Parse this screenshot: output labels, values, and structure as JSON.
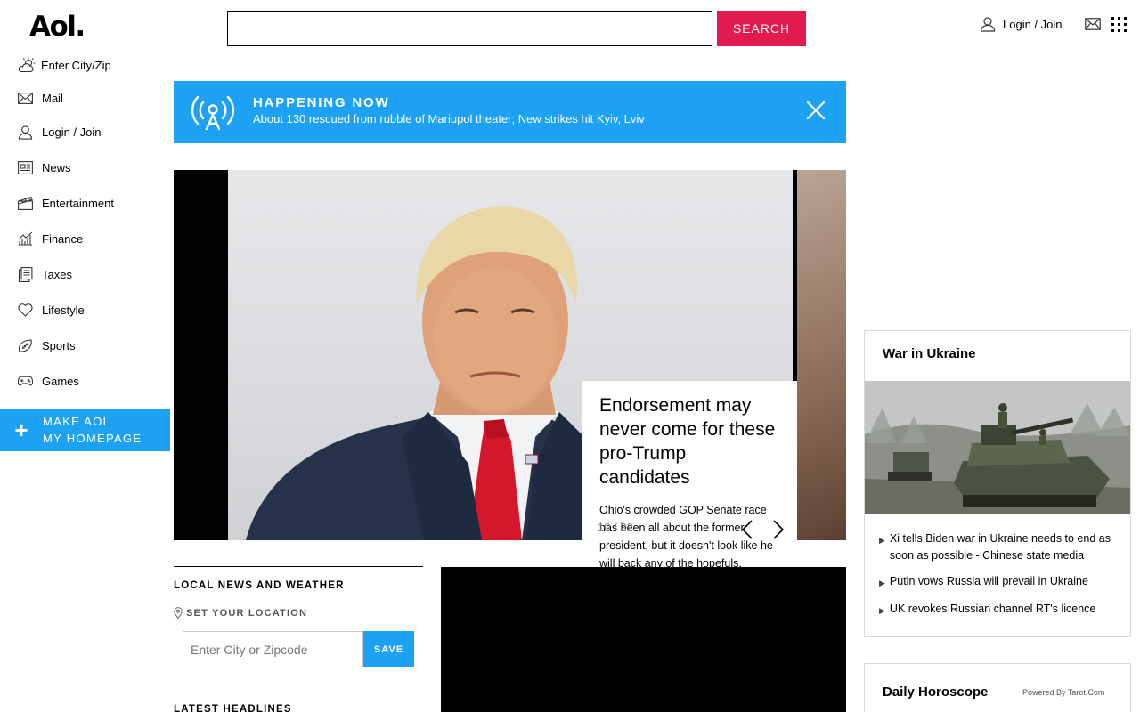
{
  "header": {
    "logo": "Aol.",
    "search_button": "SEARCH",
    "login_label": "Login / Join"
  },
  "sidebar": {
    "weather_label": "Enter City/Zip",
    "items": [
      {
        "label": "Mail",
        "icon": "mail-icon"
      },
      {
        "label": "Login / Join",
        "icon": "user-icon"
      },
      {
        "label": "News",
        "icon": "newspaper-icon"
      },
      {
        "label": "Entertainment",
        "icon": "clapperboard-icon"
      },
      {
        "label": "Finance",
        "icon": "chart-icon"
      },
      {
        "label": "Taxes",
        "icon": "documents-icon"
      },
      {
        "label": "Lifestyle",
        "icon": "heart-icon"
      },
      {
        "label": "Sports",
        "icon": "football-icon"
      },
      {
        "label": "Games",
        "icon": "gamepad-icon"
      }
    ],
    "make_homepage": {
      "line1": "MAKE AOL",
      "line2": "MY HOMEPAGE"
    }
  },
  "happening": {
    "label": "HAPPENING NOW",
    "text": "About 130 rescued from rubble of Mariupol theater; New strikes hit Kyiv, Lviv"
  },
  "carousel": {
    "headline": "Endorsement may never come for these pro-Trump candidates",
    "summary": "Ohio's crowded GOP Senate race has been all about the former president, but it doesn't look like he will back any of the hopefuls.",
    "counter": "10 / 32"
  },
  "local": {
    "title": "LOCAL NEWS AND WEATHER",
    "set_location": "SET YOUR LOCATION",
    "input_placeholder": "Enter City or Zipcode",
    "save_label": "SAVE",
    "latest_title": "LATEST HEADLINES"
  },
  "ukraine": {
    "title": "War in Ukraine",
    "headlines": [
      "Xi tells Biden war in Ukraine needs to end as soon as possible - Chinese state media",
      "Putin vows Russia will prevail in Ukraine",
      "UK revokes Russian channel RT's licence"
    ]
  },
  "horoscope": {
    "title": "Daily Horoscope",
    "powered": "Powered By Tarot.Com"
  },
  "colors": {
    "accent_blue": "#1da1f2",
    "search_red": "#e21a4f"
  }
}
